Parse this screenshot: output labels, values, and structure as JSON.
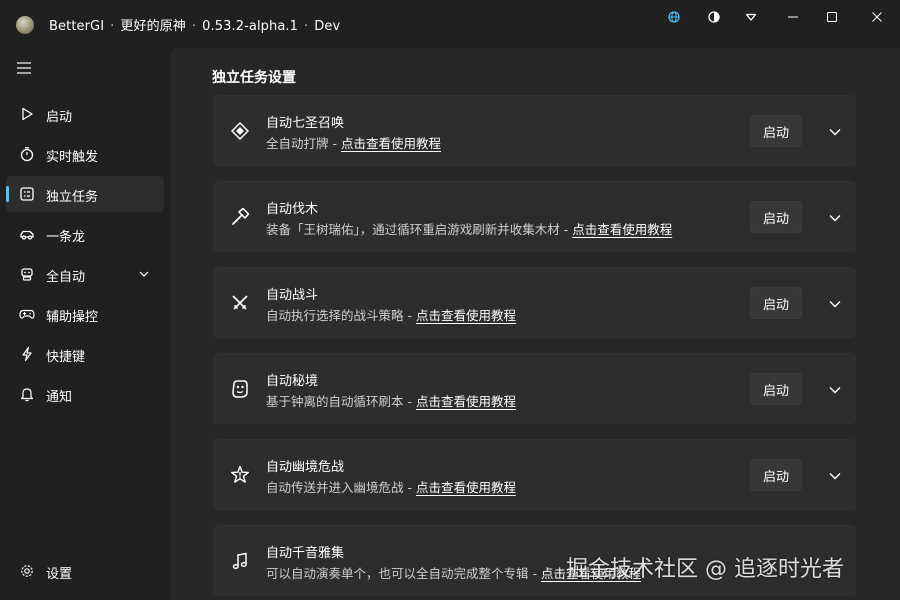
{
  "window": {
    "app_name": "BetterGI",
    "subtitle": "更好的原神",
    "version": "0.53.2-alpha.1",
    "channel": "Dev",
    "separator": "·"
  },
  "titlebar_icons": [
    "globe-icon",
    "theme-icon",
    "pin-icon",
    "minimize-icon",
    "maximize-icon",
    "close-icon"
  ],
  "accent_color": "#4cc2ff",
  "sidebar": {
    "items": [
      {
        "label": "启动",
        "icon": "play-icon"
      },
      {
        "label": "实时触发",
        "icon": "stopwatch-icon"
      },
      {
        "label": "独立任务",
        "icon": "task-list-icon",
        "active": true
      },
      {
        "label": "一条龙",
        "icon": "car-icon"
      },
      {
        "label": "全自动",
        "icon": "robot-icon",
        "expandable": true
      },
      {
        "label": "辅助操控",
        "icon": "gamepad-icon"
      },
      {
        "label": "快捷键",
        "icon": "flash-icon"
      },
      {
        "label": "通知",
        "icon": "bell-icon"
      }
    ],
    "settings_label": "设置"
  },
  "page": {
    "title": "独立任务设置"
  },
  "tasks": [
    {
      "title": "自动七圣召唤",
      "desc": "全自动打牌 - ",
      "link": "点击查看使用教程",
      "button": "启动",
      "icon": "card-duel-icon"
    },
    {
      "title": "自动伐木",
      "desc": "装备「王树瑞佑」，通过循环重启游戏刷新并收集木材 - ",
      "link": "点击查看使用教程",
      "button": "启动",
      "icon": "axe-icon"
    },
    {
      "title": "自动战斗",
      "desc": "自动执行选择的战斗策略 - ",
      "link": "点击查看使用教程",
      "button": "启动",
      "icon": "crossed-swords-icon"
    },
    {
      "title": "自动秘境",
      "desc": "基于钟离的自动循环刷本 - ",
      "link": "点击查看使用教程",
      "button": "启动",
      "icon": "domain-icon"
    },
    {
      "title": "自动幽境危战",
      "desc": "自动传送并进入幽境危战 - ",
      "link": "点击查看使用教程",
      "button": "启动",
      "icon": "star-danger-icon"
    },
    {
      "title": "自动千音雅集",
      "desc": "可以自动演奏单个，也可以全自动完成整个专辑 - ",
      "link": "点击查看使用教程",
      "icon": "music-icon"
    }
  ],
  "watermark": "掘金技术社区 @ 追逐时光者"
}
